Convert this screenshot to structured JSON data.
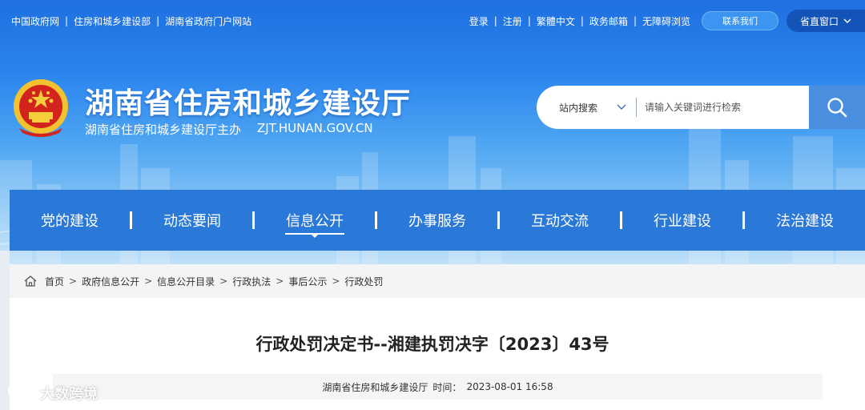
{
  "topbar": {
    "left_links": [
      "中国政府网",
      "住房和城乡建设部",
      "湖南省政府门户网站"
    ],
    "right_links": [
      "登录",
      "注册",
      "繁體中文",
      "政务邮箱",
      "无障碍浏览"
    ],
    "contact_label": "联系我们",
    "dept_label": "省直窗口"
  },
  "site": {
    "title": "湖南省住房和城乡建设厅",
    "sponsor": "湖南省住房和城乡建设厅主办",
    "domain": "ZJT.HUNAN.GOV.CN"
  },
  "search": {
    "scope": "站内搜索",
    "placeholder": "请输入关键词进行检索"
  },
  "nav": {
    "items": [
      {
        "label": "党的建设"
      },
      {
        "label": "动态要闻"
      },
      {
        "label": "信息公开"
      },
      {
        "label": "办事服务"
      },
      {
        "label": "互动交流"
      },
      {
        "label": "行业建设"
      },
      {
        "label": "法治建设"
      }
    ],
    "active_index": 2
  },
  "breadcrumb": [
    "首页",
    "政府信息公开",
    "信息公开目录",
    "行政执法",
    "事后公示",
    "行政处罚"
  ],
  "article": {
    "title": "行政处罚决定书--湘建执罚决字〔2023〕43号",
    "source": "湖南省住房和城乡建设厅",
    "time_label": "时间：",
    "time": "2023-08-01 16:58"
  },
  "watermark": "大数跨境",
  "colors": {
    "header_top": "#1f6fe0",
    "nav_bg": "#2a78d8",
    "search_btn": "#4a8ee0"
  }
}
